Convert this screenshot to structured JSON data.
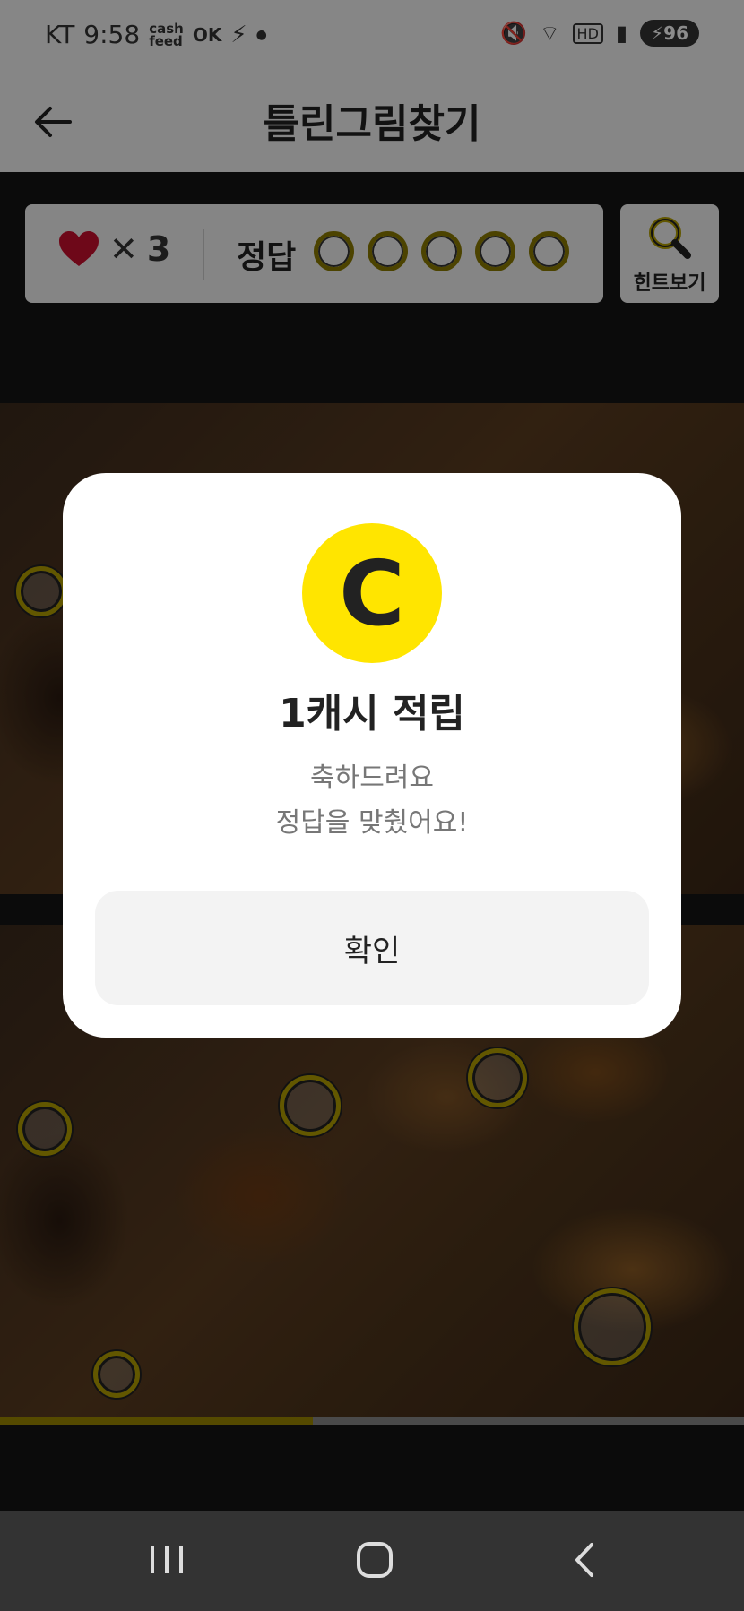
{
  "status": {
    "carrier": "KT",
    "time": "9:58",
    "app_tag": "cash\nfeed",
    "ok_badge": "OK",
    "battery": "96"
  },
  "header": {
    "title": "틀린그림찾기"
  },
  "game": {
    "lives_count": "3",
    "lives_sep": "✕",
    "answer_label": "정답",
    "answer_slots": 5,
    "hint_label": "힌트보기",
    "progress": 0.42
  },
  "modal": {
    "title": "1캐시 적립",
    "message_line1": "축하드려요",
    "message_line2": "정답을 맞췄어요!",
    "confirm_label": "확인",
    "coin_letter": "C"
  },
  "icons": {
    "back": "arrow-left-icon",
    "heart": "heart-icon",
    "hint": "magnifier-icon",
    "coin": "cash-coin-icon",
    "nav_recent": "recent-apps-icon",
    "nav_home": "home-icon",
    "nav_back": "chevron-left-icon"
  },
  "colors": {
    "accent_yellow": "#ffe500",
    "marker_ring": "#b39f00",
    "heart_red": "#c8102e"
  }
}
